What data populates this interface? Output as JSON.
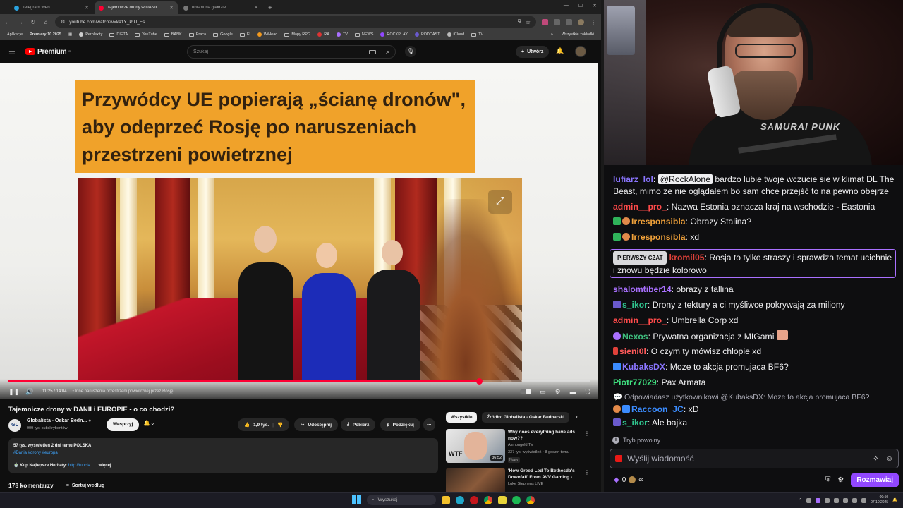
{
  "browser": {
    "tabs": [
      {
        "title": "Telegram Web",
        "color": "#2aa3df",
        "active": false
      },
      {
        "title": "Tajemnicze drony w DANII",
        "color": "#ff0033",
        "active": true
      },
      {
        "title": "ubisoft na giełdzie",
        "color": "#777777",
        "active": false
      }
    ],
    "url": "youtube.com/watch?v=ka1Y_PIU_Es",
    "bookmarks": [
      "Aplikacje",
      "Premiery 10 2025",
      "Perplexity",
      "DIETA",
      "YouTube",
      "BANK",
      "Praca",
      "Google",
      "El",
      "WiHead",
      "Mapy RPG",
      "RA",
      "TV",
      "NEWS",
      "ROCKPLAY",
      "PODCAST",
      "iCloud",
      "TV"
    ],
    "bookmarks_all": "Wszystkie zakładki"
  },
  "youtube": {
    "logo_text": "Premium",
    "logo_suffix": "PL",
    "search_placeholder": "Szukaj",
    "create_label": "Utwórz",
    "player": {
      "headline": "Przywódcy UE popierają „ścianę dronów\", aby odeprzeć Rosję po naruszeniach przestrzeni powietrznej",
      "time": "11:25 / 14:04",
      "chapter": "• Inne naruszenia przestrzeni powietrznej przez Rosję",
      "progress": 0.81
    },
    "video_title": "Tajemnicze drony w DANII i EUROPIE - o co chodzi?",
    "channel": {
      "avatar_text": "GL",
      "name": "Globalista - Oskar Bedn...",
      "subs": "909 tys. subskrybentów",
      "support_label": "Wesprzyj"
    },
    "actions": {
      "likes": "1,9 tys.",
      "share": "Udostępnij",
      "download": "Pobierz",
      "thanks": "Podziękuj"
    },
    "description": {
      "views_line": "57 tys. wyświetleń  2 dni temu  POLSKA",
      "tags": "#Dania #drony #europa",
      "promo_text": "Kup Najlepsze Herbaty:",
      "promo_link": "http://tuncia...",
      "more": "...więcej"
    },
    "comments": {
      "count": "178 komentarzy",
      "sort": "Sortuj według"
    },
    "chips": [
      "Wszystkie",
      "Źródło: Globalista - Oskar Bednarski"
    ],
    "recommendations": [
      {
        "title": "Why does everything have ads now??",
        "channel": "Asmongold TV",
        "meta": "337 tys. wyświetleń • 8 godzin temu",
        "badge": "Nowy",
        "duration": "36:52",
        "thumb_text": "WTF"
      },
      {
        "title": "'How Greed Led To Bethesda's Downfall' From AVV Gaming - ...",
        "channel": "Luke Stephens LIVE",
        "meta": "",
        "badge": "",
        "duration": "",
        "thumb_text": ""
      }
    ]
  },
  "twitch": {
    "overlay_text": "SAMURAI PUNK",
    "messages": [
      {
        "user": "lufiarz_lol",
        "color": "#8a75ff",
        "mention": "@RockAlone",
        "text": " bardzo lubie twoje wczucie sie w klimat DL The Beast, mimo że nie oglądałem bo sam chce przejść to na pewno obejrze"
      },
      {
        "user": "admin__pro_",
        "color": "#ff4a4a",
        "text": "Nazwa Estonia oznacza kraj na wschodzie - Eastonia"
      },
      {
        "user": "Irresponsibla",
        "color": "#f0a13a",
        "text": "Obrazy Stalina?"
      },
      {
        "user": "Irresponsibla",
        "color": "#f0a13a",
        "text": "xd"
      },
      {
        "first_chat_label": "PIERWSZY CZAT",
        "user": "kromil05",
        "color": "#e0413a",
        "text": "Rosja to tylko straszy i sprawdza temat ucichnie i znowu będzie kolorowo"
      },
      {
        "user": "shalomtiber14",
        "color": "#a970ff",
        "text": "obrazy z tallina"
      },
      {
        "user": "s_ikor",
        "color": "#2fc38d",
        "text": "Drony z tektury a ci myśliwce pokrywają za miliony"
      },
      {
        "user": "admin__pro_",
        "color": "#ff4a4a",
        "text": "Umbrella Corp xd"
      },
      {
        "user": "Nexos",
        "color": "#3fbf7f",
        "text": "Prywatna organizacja z MIGami"
      },
      {
        "user": "sieni0l",
        "color": "#ff5a5a",
        "text": "O czym ty mówisz chłopie xd"
      },
      {
        "user": "KubaksDX",
        "color": "#8a75ff",
        "text": "Moze to akcja promujaca BF6?"
      },
      {
        "user": "Piotr77029",
        "color": "#3fe07f",
        "text": "Pax Armata"
      },
      {
        "reply_to": "Odpowiadasz użytkownikowi @KubaksDX: Moze to akcja promujaca BF6?",
        "user": "Raccoon_JC",
        "color": "#3b8cff",
        "text": "xD"
      },
      {
        "user": "s_ikor",
        "color": "#2fc38d",
        "text": "Ale bajka"
      }
    ],
    "slow_mode": "Tryb powolny",
    "input_placeholder": "Wyślij wiadomość",
    "points": "0",
    "points_suffix": "∞",
    "send_label": "Rozmawiaj"
  },
  "taskbar": {
    "search_placeholder": "Wyszukaj",
    "time": "09:50",
    "date": "07.10.2025"
  }
}
